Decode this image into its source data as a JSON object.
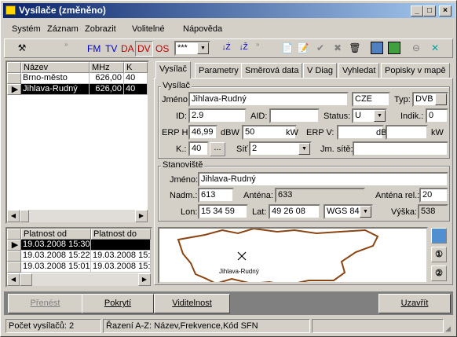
{
  "window": {
    "title": "Vysílače (změněno)",
    "min": "_",
    "max": "□",
    "close": "×"
  },
  "menu": [
    "Systém",
    "Záznam",
    "Zobrazit",
    "Volitelné",
    "Nápověda"
  ],
  "toolbar": {
    "bands": [
      {
        "label": "FM",
        "color": "#0000c0"
      },
      {
        "label": "TV",
        "color": "#0000c0"
      },
      {
        "label": "DA",
        "color": "#c00000"
      },
      {
        "label": "DV",
        "color": "#c00000"
      },
      {
        "label": "OS",
        "color": "#c00000"
      }
    ],
    "filter": "***"
  },
  "list": {
    "headers": [
      "Název",
      "MHz",
      "K"
    ],
    "rows": [
      [
        "Brno-město",
        "626,00",
        "40"
      ],
      [
        "Jihlava-Rudný",
        "626,00",
        "40"
      ]
    ]
  },
  "validity": {
    "headers": [
      "Platnost od",
      "Platnost do"
    ],
    "rows": [
      [
        "19.03.2008 15:30",
        ""
      ],
      [
        "19.03.2008 15:22",
        "19.03.2008 15:"
      ],
      [
        "19.03.2008 15:01",
        "19.03.2008 15:"
      ]
    ]
  },
  "tabs": [
    "Vysílač",
    "Parametry",
    "Směrová data",
    "V Diag",
    "Vyhledat",
    "Popisky v mapě"
  ],
  "vysilac": {
    "group": "Vysílač",
    "jmeno_l": "Jméno:",
    "jmeno": "Jihlava-Rudný",
    "country": "CZE",
    "typ_l": "Typ:",
    "typ": "DVB",
    "id_l": "ID:",
    "id": "2.9",
    "aid_l": "AID:",
    "aid": "",
    "status_l": "Status:",
    "status": "U",
    "indik_l": "Indik.:",
    "indik": "0",
    "erph_l": "ERP H:",
    "erph": "46,99",
    "dbw": "dBW",
    "erph2": "50",
    "kw": "kW",
    "erpv_l": "ERP V:",
    "erpv": "",
    "dbw2": "dBW",
    "kw2": "kW",
    "k_l": "K.:",
    "k": "40",
    "k_btn": "...",
    "sit_l": "Síť",
    "sit": "2",
    "jmsite_l": "Jm. sítě:",
    "jmsite": ""
  },
  "stanoviste": {
    "group": "Stanoviště",
    "jmeno_l": "Jméno:",
    "jmeno": "Jihlava-Rudný",
    "nadm_l": "Nadm.:",
    "nadm": "613",
    "antena_l": "Anténa:",
    "antena": "633",
    "antrel_l": "Anténa rel.:",
    "antrel": "20",
    "lon_l": "Lon:",
    "lon": "15 34 59",
    "lat_l": "Lat:",
    "lat": "49 26 08",
    "wgs": "WGS 84",
    "vyska_l": "Výška:",
    "vyska": "538"
  },
  "map": {
    "marker": "Jihlava-Rudný"
  },
  "buttons": {
    "prenest": "Přenést",
    "pokryti": "Pokrytí",
    "viditelnost": "Viditelnost",
    "zavrit": "Uzavřít"
  },
  "status": {
    "count": "Počet vysílačů: 2",
    "sort": "Řazení A-Z: Název,Frekvence,Kód SFN"
  }
}
